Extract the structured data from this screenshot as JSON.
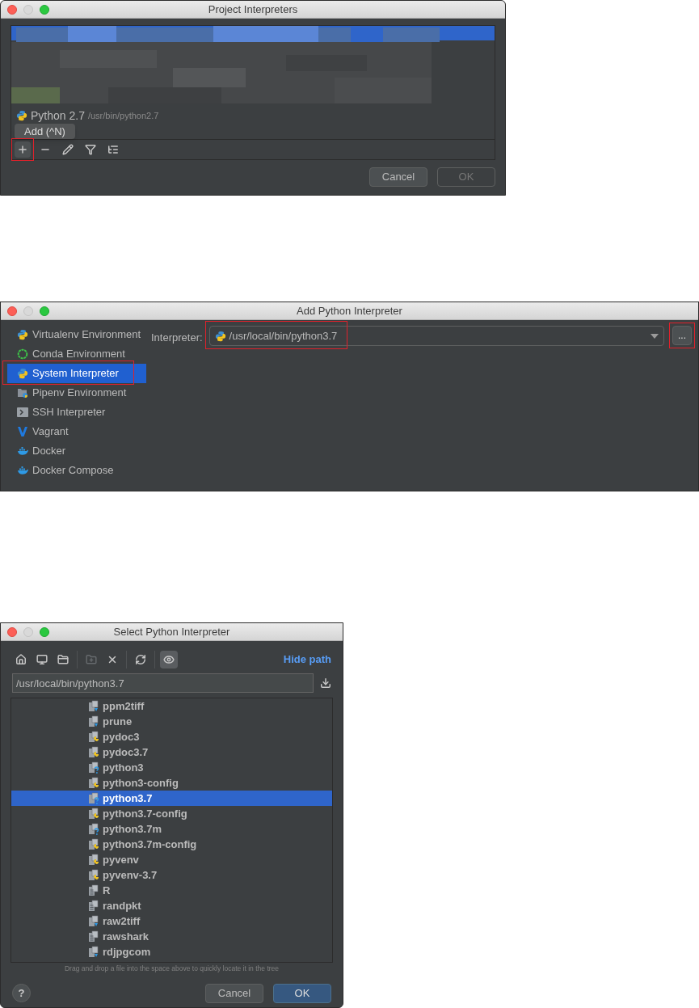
{
  "project_interpreters": {
    "title": "Project Interpreters",
    "interpreter": {
      "name": "Python 2.7",
      "path": "/usr/bin/python2.7"
    },
    "tooltip": "Add (^N)",
    "tools": [
      {
        "kind": "add",
        "highlighted": true
      },
      {
        "kind": "remove",
        "highlighted": false
      },
      {
        "kind": "edit",
        "highlighted": false
      },
      {
        "kind": "filter",
        "highlighted": false
      },
      {
        "kind": "tree",
        "highlighted": false
      }
    ],
    "buttons": [
      {
        "label": "Cancel",
        "disabled": false
      },
      {
        "label": "OK",
        "disabled": true
      }
    ]
  },
  "add_interpreter": {
    "title": "Add Python Interpreter",
    "sidebar": [
      {
        "label": "Virtualenv Environment",
        "kind": "virtualenv",
        "selected": false,
        "highlighted": false
      },
      {
        "label": "Conda Environment",
        "kind": "conda",
        "selected": false,
        "highlighted": false
      },
      {
        "label": "System Interpreter",
        "kind": "python",
        "selected": true,
        "highlighted": true
      },
      {
        "label": "Pipenv Environment",
        "kind": "pipenv",
        "selected": false,
        "highlighted": false
      },
      {
        "label": "SSH Interpreter",
        "kind": "ssh",
        "selected": false,
        "highlighted": false
      },
      {
        "label": "Vagrant",
        "kind": "vagrant",
        "selected": false,
        "highlighted": false
      },
      {
        "label": "Docker",
        "kind": "docker",
        "selected": false,
        "highlighted": false
      },
      {
        "label": "Docker Compose",
        "kind": "docker",
        "selected": false,
        "highlighted": false
      }
    ],
    "field_label": "Interpreter:",
    "field_value": "/usr/local/bin/python3.7",
    "field_highlighted": true,
    "browse": {
      "label": "...",
      "highlighted": true
    }
  },
  "select_interpreter": {
    "title": "Select Python Interpreter",
    "tools": [
      {
        "kind": "home",
        "disabled": false,
        "on": false
      },
      {
        "kind": "desktop",
        "disabled": false,
        "on": false
      },
      {
        "kind": "module",
        "disabled": false,
        "on": false
      },
      {
        "kind": "separator"
      },
      {
        "kind": "new-folder",
        "disabled": true,
        "on": false
      },
      {
        "kind": "delete",
        "disabled": false,
        "on": false
      },
      {
        "kind": "separator"
      },
      {
        "kind": "refresh",
        "disabled": false,
        "on": false
      },
      {
        "kind": "separator"
      },
      {
        "kind": "hidden",
        "disabled": false,
        "on": true
      }
    ],
    "hide_path": "Hide path",
    "path": "/usr/local/bin/python3.7",
    "files": [
      {
        "name": "ppm2tiff",
        "kind": "binary",
        "selected": false
      },
      {
        "name": "prune",
        "kind": "binary",
        "selected": false
      },
      {
        "name": "pydoc3",
        "kind": "python",
        "selected": false
      },
      {
        "name": "pydoc3.7",
        "kind": "python",
        "selected": false
      },
      {
        "name": "python3",
        "kind": "unknown",
        "selected": false
      },
      {
        "name": "python3-config",
        "kind": "python",
        "selected": false
      },
      {
        "name": "python3.7",
        "kind": "unknown",
        "selected": true
      },
      {
        "name": "python3.7-config",
        "kind": "python",
        "selected": false
      },
      {
        "name": "python3.7m",
        "kind": "unknown",
        "selected": false
      },
      {
        "name": "python3.7m-config",
        "kind": "python",
        "selected": false
      },
      {
        "name": "pyvenv",
        "kind": "python",
        "selected": false
      },
      {
        "name": "pyvenv-3.7",
        "kind": "python",
        "selected": false
      },
      {
        "name": "R",
        "kind": "text",
        "selected": false
      },
      {
        "name": "randpkt",
        "kind": "text",
        "selected": false
      },
      {
        "name": "raw2tiff",
        "kind": "binary",
        "selected": false
      },
      {
        "name": "rawshark",
        "kind": "text",
        "selected": false
      },
      {
        "name": "rdjpgcom",
        "kind": "binary",
        "selected": false
      }
    ],
    "hint": "Drag and drop a file into the space above to quickly locate it in the tree",
    "help": "?",
    "buttons": [
      {
        "label": "Cancel",
        "primary": false
      },
      {
        "label": "OK",
        "primary": true
      }
    ]
  }
}
